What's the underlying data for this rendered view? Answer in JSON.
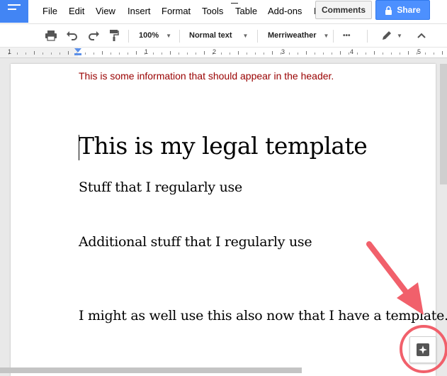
{
  "menu": {
    "items": [
      "File",
      "Edit",
      "View",
      "Insert",
      "Format",
      "Tools",
      "Table",
      "Add-ons",
      "H"
    ]
  },
  "header_buttons": {
    "comments": "Comments",
    "share": "Share"
  },
  "toolbar": {
    "zoom": "100%",
    "style": "Normal text",
    "font": "Merriweather",
    "more": "•••"
  },
  "ruler": {
    "numbers": [
      "1",
      "1",
      "2",
      "3",
      "4",
      "5"
    ]
  },
  "document": {
    "header_text": "This is some information that should appear in the header.",
    "title": "This is my legal template",
    "paragraphs": [
      "Stuff that I regularly use",
      "Additional stuff that I regularly use",
      "I might as well use this also now that I have a template."
    ]
  },
  "colors": {
    "brand": "#4285f4",
    "share": "#4d90fe",
    "header_text": "#990000",
    "annotation": "#f1606b"
  },
  "icons": [
    "docs-logo-icon",
    "print-icon",
    "undo-icon",
    "redo-icon",
    "paint-format-icon",
    "lock-icon",
    "pencil-icon",
    "chevron-up-icon",
    "explore-icon"
  ]
}
